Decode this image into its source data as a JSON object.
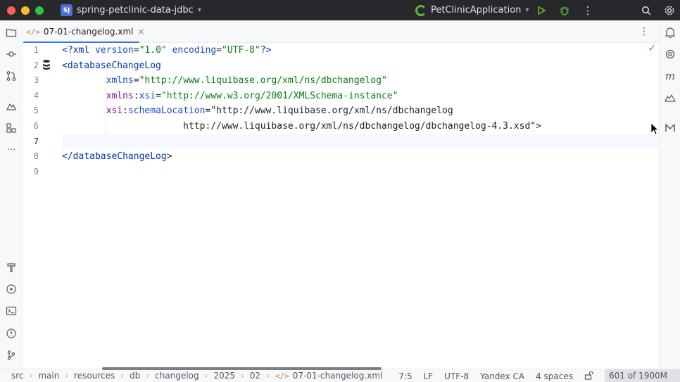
{
  "titlebar": {
    "project_badge": "SJ",
    "project_name": "spring-petclinic-data-jdbc",
    "run_config": "PetClinicApplication"
  },
  "tab": {
    "filename": "07-01-changelog.xml",
    "close_glyph": "×",
    "menu_glyph": "⋮"
  },
  "editor": {
    "line_numbers": [
      "1",
      "2",
      "3",
      "4",
      "5",
      "6",
      "7",
      "8",
      "9"
    ],
    "current_line": "7",
    "lines": [
      "<?xml version=\"1.0\" encoding=\"UTF-8\"?>",
      "<databaseChangeLog",
      "        xmlns=\"http://www.liquibase.org/xml/ns/dbchangelog\"",
      "        xmlns:xsi=\"http://www.w3.org/2001/XMLSchema-instance\"",
      "        xsi:schemaLocation=\"http://www.liquibase.org/xml/ns/dbchangelog",
      "                      http://www.liquibase.org/xml/ns/dbchangelog/dbchangelog-4.3.xsd\">",
      "",
      "</databaseChangeLog>",
      ""
    ],
    "inspection_glyph": "✓"
  },
  "statusbar": {
    "breadcrumbs": [
      "src",
      "main",
      "resources",
      "db",
      "changelog",
      "2025",
      "02",
      "07-01-changelog.xml"
    ],
    "position": "7:5",
    "line_separator": "LF",
    "encoding": "UTF-8",
    "code_style": "Yandex CA",
    "indent": "4 spaces",
    "memory": "601 of 1900M"
  },
  "colors": {
    "accent": "#3574f0",
    "titlebar_bg": "#27282c",
    "xml_tag": "#0033b3",
    "xml_value": "#067d17",
    "xml_namespace": "#871094"
  },
  "icons": {
    "left": [
      "folder-icon",
      "commit-icon",
      "pull-requests-icon",
      "structure-icon",
      "services-icon",
      "more-icon",
      "build-icon",
      "run-icon",
      "terminal-icon",
      "problems-icon",
      "git-icon"
    ],
    "right": [
      "notifications-icon",
      "ai-assistant-icon",
      "maven-icon",
      "database-icon",
      "markdown-icon"
    ]
  }
}
